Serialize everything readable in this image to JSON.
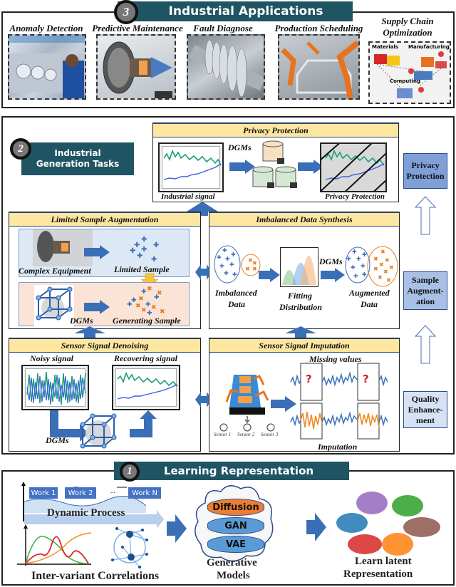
{
  "applications": {
    "badge": "3",
    "title": "Industrial Applications",
    "items": [
      {
        "label": "Anomaly Detection",
        "image": "factory-worker-inspection-photo"
      },
      {
        "label": "Predictive Maintenance",
        "image": "turbine-engine-cutaway-photo"
      },
      {
        "label": "Fault Diagnose",
        "image": "steam-turbine-rotor-photo"
      },
      {
        "label": "Production Scheduling",
        "image": "robotic-car-assembly-photo"
      },
      {
        "label_line1": "Supply Chain",
        "label_line2": "Optimization",
        "image": "supply-chain-diagram",
        "sub_labels": {
          "materials": "Materials",
          "manufacturing": "Manufacturing",
          "computing": "Computing"
        }
      }
    ]
  },
  "generation": {
    "badge": "2",
    "title_line1": "Industrial",
    "title_line2": "Generation Tasks",
    "privacy": {
      "header": "Privacy Protection",
      "input_label": "Industrial signal",
      "method_label": "DGMs",
      "output_label": "Privacy Protection"
    },
    "limited": {
      "header": "Limited Sample Augmentation",
      "equipment_label": "Complex Equipment",
      "limited_label": "Limited Sample",
      "dgm_label": "DGMs",
      "generating_label": "Generating Sample"
    },
    "imbalanced": {
      "header": "Imbalanced Data Synthesis",
      "imbalanced_line1": "Imbalanced",
      "imbalanced_line2": "Data",
      "fitting_line1": "Fitting",
      "fitting_line2": "Distribution",
      "method_label": "DGMs",
      "augmented_line1": "Augmented",
      "augmented_line2": "Data"
    },
    "denoising": {
      "header": "Sensor Signal Denoising",
      "noisy_label": "Noisy signal",
      "recover_label": "Recovering signal",
      "method_label": "DGMs"
    },
    "imputation": {
      "header": "Sensor Signal Imputation",
      "missing_label": "Missing values",
      "imputation_label": "Imputation",
      "question_mark": "?",
      "sensors": [
        "Sensor 1",
        "Sensor 2",
        "Sensor 3"
      ]
    },
    "levels": [
      {
        "line1": "Privacy",
        "line2": "Protection",
        "color": "#7f9fd6"
      },
      {
        "line1": "Sample",
        "line2": "Augment-",
        "line3": "ation",
        "color": "#a9c0e6"
      },
      {
        "line1": "Quality",
        "line2": "Enhance-",
        "line3": "ment",
        "color": "#d6e1f3"
      }
    ]
  },
  "learning": {
    "badge": "1",
    "title": "Learning Representation",
    "works": [
      "Work 1",
      "Work 2",
      "...",
      "Work N"
    ],
    "dynamic_label": "Dynamic Process",
    "correlation_label": "Inter-variant Correlations",
    "models": [
      "Diffusion",
      "GAN",
      "VAE"
    ],
    "models_line1": "Generative",
    "models_line2": "Models",
    "latent_line1": "Learn latent",
    "latent_line2": "Representation"
  },
  "colors": {
    "banner": "#1f5563",
    "panel_header": "#fde7a0",
    "arrow_blue": "#3a6fb8",
    "signal_green": "#1a9e7a",
    "signal_blue": "#3b5ee0",
    "orange": "#e67e22",
    "diffusion": "#ed7d31",
    "layer_blue": "#5b9bd5"
  }
}
